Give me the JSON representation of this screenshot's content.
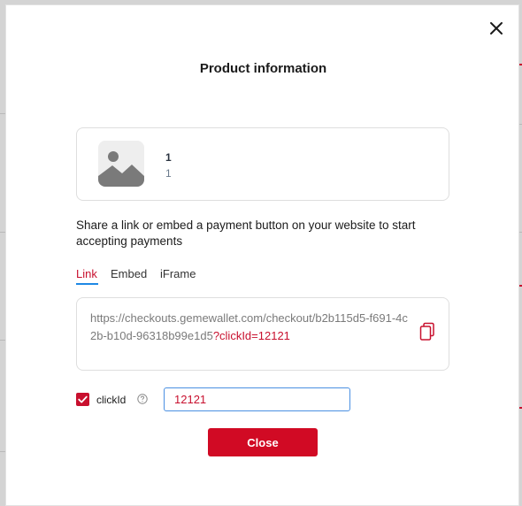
{
  "modal": {
    "title": "Product information",
    "close_icon": "close-icon"
  },
  "product": {
    "name": "1",
    "subtitle": "1",
    "image_icon": "image-placeholder-icon"
  },
  "description": "Share a link or embed a payment button on your website to start accepting payments",
  "tabs": [
    {
      "label": "Link",
      "active": true
    },
    {
      "label": "Embed",
      "active": false
    },
    {
      "label": "iFrame",
      "active": false
    }
  ],
  "link": {
    "base_url": "https://checkouts.gemewallet.com/checkout/b2b115d5-f691-4c2b-b10d-96318b99e1d5",
    "param": "?clickId=12121",
    "copy_icon": "copy-icon"
  },
  "click_id": {
    "checked": true,
    "label": "clickId",
    "help_icon": "help-circle-icon",
    "value": "12121"
  },
  "footer": {
    "close_label": "Close"
  },
  "colors": {
    "accent": "#d10a24",
    "tab_underline": "#1e88e5",
    "input_border": "#4a90e2"
  }
}
